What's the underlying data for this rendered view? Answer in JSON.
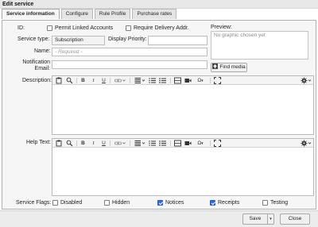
{
  "window": {
    "title": "Edit service"
  },
  "tabs": [
    {
      "label": "Service information",
      "active": true
    },
    {
      "label": "Configure",
      "active": false
    },
    {
      "label": "Rule Profile",
      "active": false
    },
    {
      "label": "Purchase rates",
      "active": false
    }
  ],
  "form": {
    "id_label": "ID:",
    "permit_linked": {
      "label": "Permit Linked Accounts",
      "checked": false
    },
    "require_delivery": {
      "label": "Require Delivery Addr.",
      "checked": false
    },
    "service_type_label": "Service type:",
    "service_type_value": "Subscription",
    "display_priority_label": "Display Priority:",
    "display_priority_value": "",
    "name_label": "Name:",
    "name_placeholder": "- Required -",
    "notification_label_1": "Notification",
    "notification_label_2": "Email:",
    "notification_value": "",
    "preview_label": "Preview:",
    "preview_text": "No graphic chosen yet",
    "find_media_label": "Find media",
    "description_label": "Description:",
    "help_text_label": "Help Text:",
    "service_flags_label": "Service Flags:",
    "flags": [
      {
        "label": "Disabled",
        "checked": false
      },
      {
        "label": "Hidden",
        "checked": false
      },
      {
        "label": "Notices",
        "checked": true
      },
      {
        "label": "Receipts",
        "checked": true
      },
      {
        "label": "Testing",
        "checked": false
      }
    ]
  },
  "editor_toolbar": {
    "bold": "B",
    "italic": "I",
    "underline": "U",
    "omega": "Ω"
  },
  "footer": {
    "save_label": "Save",
    "close_label": "Close"
  },
  "colors": {
    "accent": "#2b6cde"
  }
}
